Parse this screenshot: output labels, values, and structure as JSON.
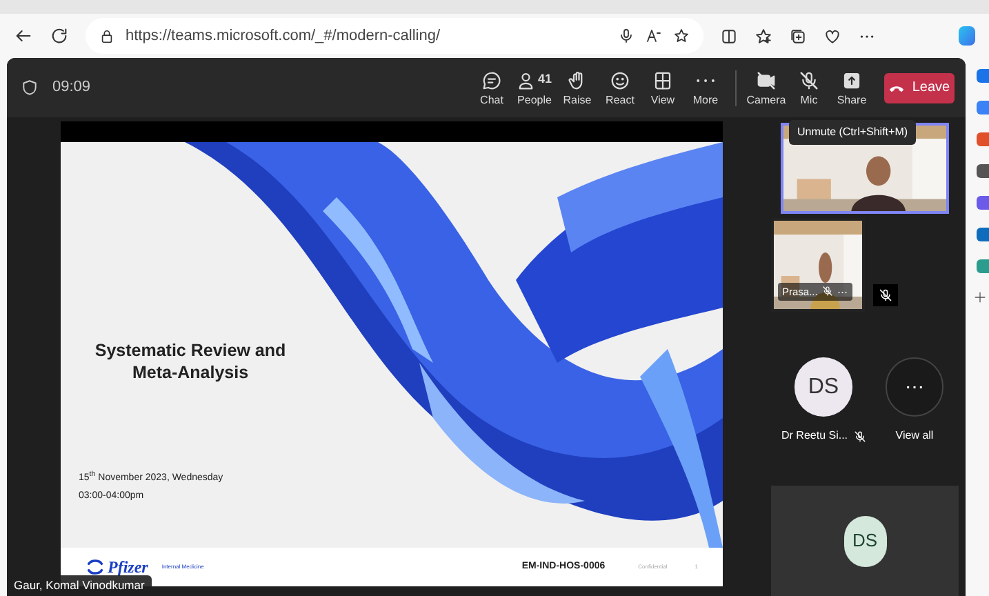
{
  "browser": {
    "url": "https://teams.microsoft.com/_#/modern-calling/"
  },
  "meeting": {
    "time": "09:09",
    "toolbar": [
      {
        "kind": "chat",
        "label": "Chat"
      },
      {
        "kind": "people",
        "label": "People",
        "count": "41"
      },
      {
        "kind": "raise",
        "label": "Raise"
      },
      {
        "kind": "react",
        "label": "React"
      },
      {
        "kind": "view",
        "label": "View"
      },
      {
        "kind": "more",
        "label": "More"
      },
      {
        "kind": "camera",
        "label": "Camera",
        "off": true
      },
      {
        "kind": "mic",
        "label": "Mic",
        "off": true
      },
      {
        "kind": "share",
        "label": "Share"
      }
    ],
    "leave": "Leave",
    "tooltip": "Unmute (Ctrl+Shift+M)",
    "slide": {
      "title": "Systematic Review and Meta-Analysis",
      "date": "15$^{th}$ November 2023, Wednesday",
      "hours": "03:00-04:00pm",
      "logo": "Pfizer",
      "department": "Internal Medicine",
      "code": "EM-IND-HOS-0006",
      "classification": "Confidential",
      "page": "1"
    },
    "presenter": "Gaur, Komal Vinodkumar",
    "video_tiles": [
      {
        "highlighted": true
      },
      {
        "highlighted": false,
        "name": "Prasa...",
        "muted": true,
        "more": "⋯"
      }
    ],
    "avatars": [
      {
        "kind": "person",
        "initials": "DS",
        "name": "Dr Reetu Si...",
        "muted": true
      },
      {
        "kind": "overflow",
        "symbol": "⋯",
        "name": "View all"
      }
    ],
    "self_tile": {
      "initials": "DS"
    }
  }
}
